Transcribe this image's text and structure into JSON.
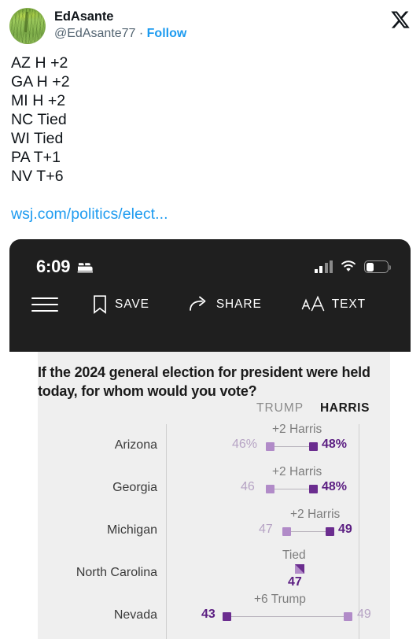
{
  "tweet": {
    "display_name": "EdAsante",
    "handle": "@EdAsante77",
    "separator": "·",
    "follow_label": "Follow",
    "x_logo_name": "x-logo-icon",
    "body_lines": [
      "AZ H +2",
      "GA H +2",
      "MI H +2",
      "NC Tied",
      "WI Tied",
      "PA T+1",
      "NV T+6"
    ],
    "link_text": "wsj.com/politics/elect..."
  },
  "card": {
    "statusbar": {
      "time": "6:09",
      "sleep_icon": "bed-icon",
      "cellular_icon": "cellular-signal-icon",
      "wifi_icon": "wifi-icon",
      "battery_icon": "battery-icon"
    },
    "toolbar": {
      "menu_label": "menu",
      "save_label": "SAVE",
      "share_label": "SHARE",
      "text_label": "TEXT"
    }
  },
  "chart_data": {
    "type": "bar",
    "title": "If the 2024 general election for president were held today, for whom would you vote?",
    "xlabel": "",
    "ylabel": "",
    "grid": false,
    "legend_position": "top-right",
    "legend": [
      "TRUMP",
      "HARRIS"
    ],
    "colors": {
      "trump": "#b18bc8",
      "harris": "#6b2d8f",
      "trump_text": "#b6a3c4",
      "harris_text": "#5b1e82",
      "connector": "#b9b4bd",
      "panel_bg": "#efefef",
      "axis": "#cfcfcf"
    },
    "axis_range": [
      40,
      52
    ],
    "categories": [
      "Arizona",
      "Georgia",
      "Michigan",
      "North Carolina",
      "Nevada"
    ],
    "series": [
      {
        "name": "TRUMP",
        "values": [
          46,
          46,
          47,
          47,
          49
        ]
      },
      {
        "name": "HARRIS",
        "values": [
          48,
          48,
          49,
          47,
          43
        ]
      }
    ],
    "rows": [
      {
        "state": "Arizona",
        "trump_value": "46%",
        "harris_value": "48%",
        "delta": "+2 Harris",
        "tied": false
      },
      {
        "state": "Georgia",
        "trump_value": "46",
        "harris_value": "48%",
        "delta": "+2 Harris",
        "tied": false
      },
      {
        "state": "Michigan",
        "trump_value": "47",
        "harris_value": "49",
        "delta": "+2 Harris",
        "tied": false
      },
      {
        "state": "North Carolina",
        "trump_value": "47",
        "harris_value": "47",
        "delta": "Tied",
        "tied": true,
        "tied_value": "47"
      },
      {
        "state": "Nevada",
        "trump_value": "49",
        "harris_value": "43",
        "delta": "+6 Trump",
        "tied": false
      }
    ]
  }
}
